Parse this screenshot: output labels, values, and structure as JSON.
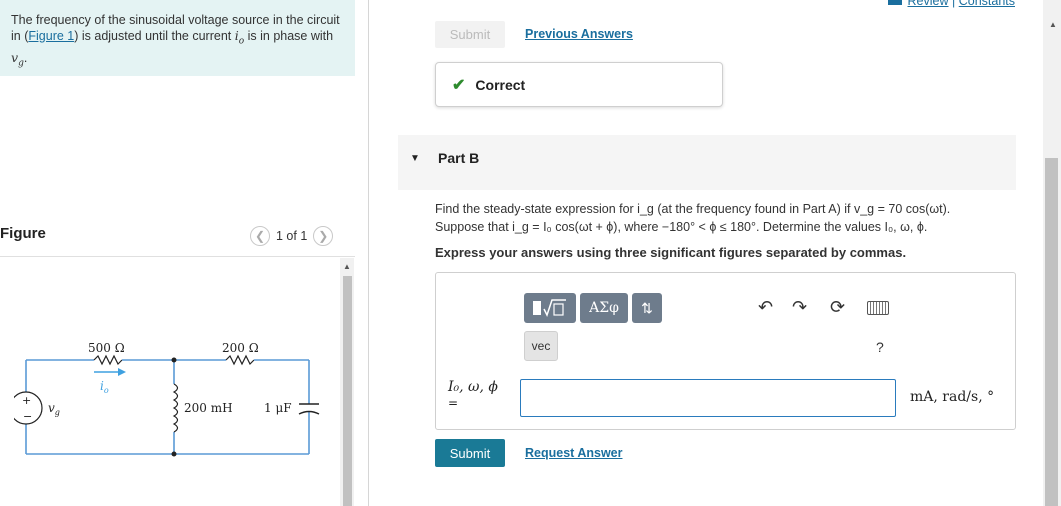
{
  "problem": {
    "text_before": "The frequency of the sinusoidal voltage source in the circuit in (",
    "figure_link": "Figure 1",
    "text_after": ") is adjusted until the current ",
    "current_var": "i",
    "current_sub": "o",
    "text_mid": " is in phase with ",
    "source_var": "v",
    "source_sub": "g",
    "text_end": "."
  },
  "figure": {
    "heading": "Figure",
    "pager": "1 of 1",
    "prev_icon": "chevron-left-icon",
    "next_icon": "chevron-right-icon",
    "labels": {
      "r1": "500 Ω",
      "r2": "200 Ω",
      "current": "i",
      "current_sub": "o",
      "source": "v",
      "source_sub": "g",
      "inductor": "200 mH",
      "capacitor": "1 μF",
      "plus": "+",
      "minus": "−"
    }
  },
  "header": {
    "review": "Review",
    "separator": "|",
    "constants": "Constants"
  },
  "part_a": {
    "submit_label": "Submit",
    "previous_answers": "Previous Answers",
    "status": "Correct",
    "status_icon": "checkmark-icon"
  },
  "part_b": {
    "title": "Part B",
    "question_line1": "Find the steady-state expression for i_g (at the frequency found in Part A) if v_g = 70 cos(ωt).",
    "question_line2": "Suppose that i_g = I₀ cos(ωt + ϕ), where −180° < ϕ ≤ 180°. Determine the values I₀, ω, ϕ.",
    "instruction": "Express your answers using three significant figures separated by commas.",
    "toolbar": {
      "templates_icon": "templates-icon",
      "greek_label": "ΑΣφ",
      "arrows_icon": "arrows-updown-icon",
      "vec_label": "vec",
      "undo_icon": "undo-icon",
      "redo_icon": "redo-icon",
      "reset_icon": "reset-icon",
      "keyboard_icon": "keyboard-icon",
      "help_label": "?"
    },
    "answer_label": "I₀, ω, ϕ",
    "answer_equals": "=",
    "answer_value": "",
    "units": "mA, rad/s, °",
    "submit_label": "Submit",
    "request_answer": "Request Answer"
  },
  "colors": {
    "problem_bg": "#e4f3f3",
    "link": "#1a6e9e",
    "submit_bg": "#1a7a96",
    "correct_check": "#2e8b2e",
    "input_border": "#2a7bbd",
    "wire": "#5a9ad6"
  }
}
